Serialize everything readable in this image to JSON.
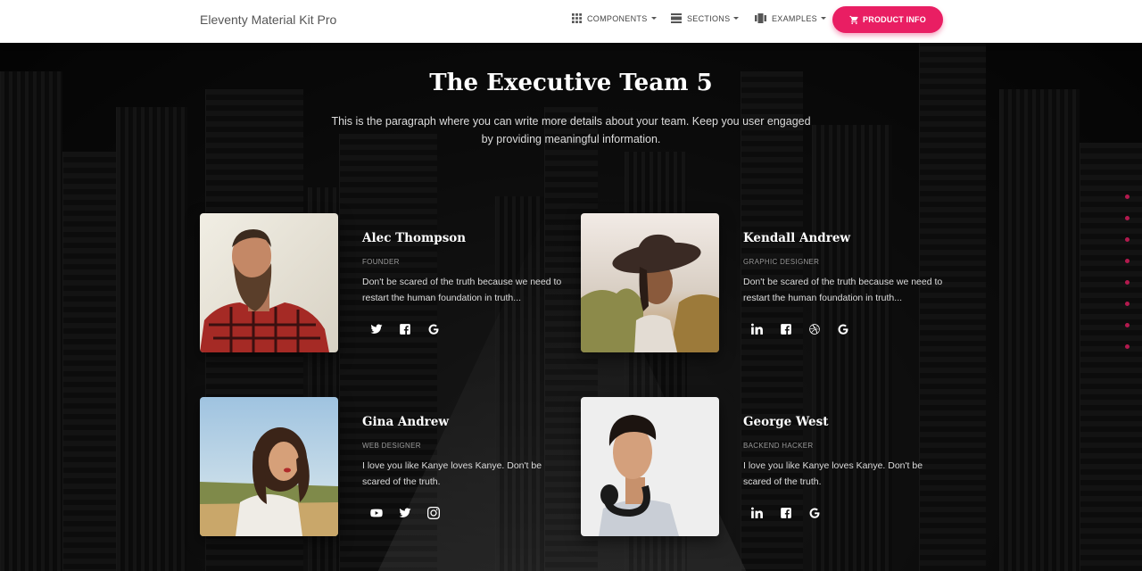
{
  "navbar": {
    "brand": "Eleventy Material Kit Pro",
    "items": [
      {
        "label": "COMPONENTS",
        "icon": "apps-icon"
      },
      {
        "label": "SECTIONS",
        "icon": "view-day-icon"
      },
      {
        "label": "EXAMPLES",
        "icon": "view-carousel-icon"
      }
    ],
    "cta_label": "PRODUCT INFO",
    "cta_icon": "shopping-cart-icon",
    "accent": "#e91e63"
  },
  "header": {
    "title": "The Executive Team 5",
    "description": "This is the paragraph where you can write more details about your team. Keep you user engaged by providing meaningful information."
  },
  "team": [
    {
      "name": "Alec Thompson",
      "role": "FOUNDER",
      "bio": "Don't be scared of the truth because we need to restart the human foundation in truth...",
      "socials": [
        "twitter-icon",
        "facebook-icon",
        "google-icon"
      ]
    },
    {
      "name": "Kendall Andrew",
      "role": "GRAPHIC DESIGNER",
      "bio": "Don't be scared of the truth because we need to restart the human foundation in truth...",
      "socials": [
        "linkedin-icon",
        "facebook-icon",
        "dribbble-icon",
        "google-icon"
      ]
    },
    {
      "name": "Gina Andrew",
      "role": "WEB DESIGNER",
      "bio": "I love you like Kanye loves Kanye. Don't be scared of the truth.",
      "socials": [
        "youtube-icon",
        "twitter-icon",
        "instagram-icon"
      ]
    },
    {
      "name": "George West",
      "role": "BACKEND HACKER",
      "bio": "I love you like Kanye loves Kanye. Don't be scared of the truth.",
      "socials": [
        "linkedin-icon",
        "facebook-icon",
        "google-icon"
      ]
    }
  ],
  "section_dots": 8
}
